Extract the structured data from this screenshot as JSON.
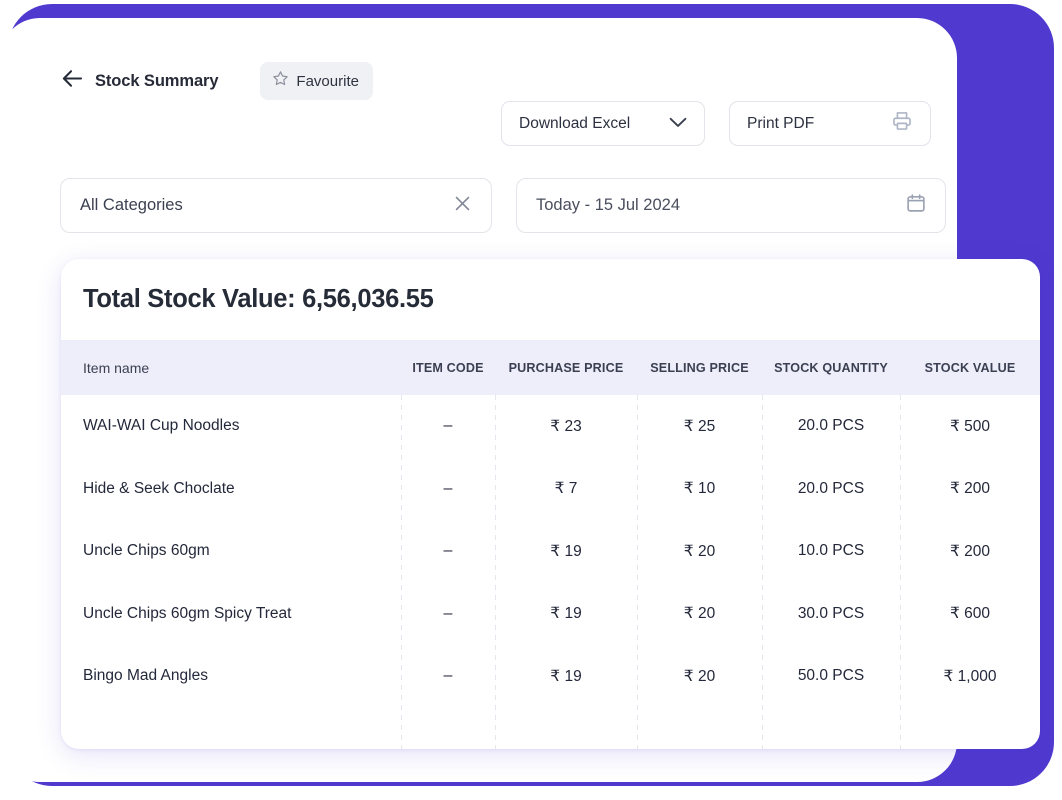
{
  "header": {
    "back_icon": "arrow-left-icon",
    "title": "Stock Summary",
    "favourite": {
      "icon": "star-outline-icon",
      "label": "Favourite"
    }
  },
  "toolbar": {
    "download_excel": {
      "label": "Download Excel",
      "icon": "chevron-down-icon"
    },
    "print_pdf": {
      "label": "Print PDF",
      "icon": "printer-icon"
    }
  },
  "filters": {
    "category": {
      "value": "All Categories",
      "placeholder": "All Categories",
      "clear_icon": "close-x-icon"
    },
    "date_range": {
      "value": "Today - 15 Jul 2024",
      "icon": "calendar-icon"
    }
  },
  "summary": {
    "total_label": "Total Stock Value: 6,56,036.55"
  },
  "table": {
    "columns": [
      "Item name",
      "ITEM CODE",
      "PURCHASE PRICE",
      "SELLING PRICE",
      "STOCK QUANTITY",
      "STOCK VALUE"
    ],
    "rows": [
      {
        "name": "WAI-WAI Cup Noodles",
        "code": "–",
        "purchase_price": "₹ 23",
        "selling_price": "₹ 25",
        "stock_quantity": "20.0 PCS",
        "stock_value": "₹ 500"
      },
      {
        "name": "Hide & Seek Choclate",
        "code": "–",
        "purchase_price": "₹ 7",
        "selling_price": "₹ 10",
        "stock_quantity": "20.0 PCS",
        "stock_value": "₹ 200"
      },
      {
        "name": "Uncle Chips 60gm",
        "code": "–",
        "purchase_price": "₹ 19",
        "selling_price": "₹ 20",
        "stock_quantity": "10.0 PCS",
        "stock_value": "₹ 200"
      },
      {
        "name": "Uncle Chips 60gm Spicy Treat",
        "code": "–",
        "purchase_price": "₹ 19",
        "selling_price": "₹ 20",
        "stock_quantity": "30.0 PCS",
        "stock_value": "₹ 600"
      },
      {
        "name": "Bingo Mad Angles",
        "code": "–",
        "purchase_price": "₹ 19",
        "selling_price": "₹ 20",
        "stock_quantity": "50.0 PCS",
        "stock_value": "₹ 1,000"
      }
    ]
  },
  "colors": {
    "accent_purple": "#4f39cf",
    "header_band": "#eeeefa",
    "text_dark": "#262b38",
    "border": "#e2e4ea",
    "pill_grey": "#f0f1f4"
  }
}
